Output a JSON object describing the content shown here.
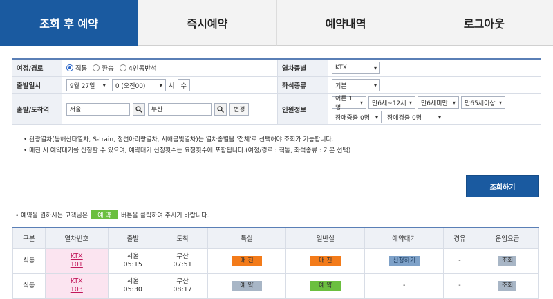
{
  "tabs": [
    "조회 후 예약",
    "즉시예약",
    "예약내역",
    "로그아웃"
  ],
  "form": {
    "route_label": "여정/경로",
    "route_options": [
      "직통",
      "환승",
      "4인동반석"
    ],
    "train_type_label": "열차종별",
    "train_type_value": "KTX",
    "depart_label": "출발일시",
    "date_value": "9월 27일",
    "time_value": "0 (오전00)",
    "hour_unit": "시",
    "weekday": "수",
    "seat_label": "좌석종류",
    "seat_value": "기본",
    "station_label": "출발/도착역",
    "from_station": "서울",
    "to_station": "부산",
    "swap_label": "변경",
    "passenger_label": "인원정보",
    "passengers": [
      "어른 1명",
      "만6세~12세",
      "만6세미만",
      "만65세이상",
      "장애중증 0명",
      "장애경증 0명"
    ]
  },
  "notes": [
    "• 관광열차(동해산타열차, S-train, 정선아리랑열차, 서해금빛열차)는 열차종별을 '전체'로 선택해야 조회가 가능합니다.",
    "• 매진 시 예약대기를 신청할 수 있으며, 예약대기 신청횟수는 요청횟수에 포함됩니다.(여정/경로 : 직통, 좌석종류 : 기본 선택)"
  ],
  "search_button": "조회하기",
  "tip": {
    "prefix": "• 예약을 원하시는 고객님은",
    "badge": "예 약",
    "suffix": "버튼을 클릭하여 주시기 바랍니다."
  },
  "table": {
    "headers": [
      "구분",
      "열차번호",
      "출발",
      "도착",
      "특실",
      "일반실",
      "예약대기",
      "경유",
      "운임요금"
    ],
    "rows": [
      {
        "type": "직통",
        "train": "KTX",
        "no": "101",
        "dep_st": "서울",
        "dep_t": "05:15",
        "arr_st": "부산",
        "arr_t": "07:51",
        "first": "매 진",
        "normal": "매 진",
        "wait": "신청하기",
        "via": "-",
        "fare": "조회"
      },
      {
        "type": "직통",
        "train": "KTX",
        "no": "103",
        "dep_st": "서울",
        "dep_t": "05:30",
        "arr_st": "부산",
        "arr_t": "08:17",
        "first": "예 약",
        "normal": "예 약",
        "wait": "-",
        "via": "-",
        "fare": "조회"
      }
    ]
  },
  "colors": {
    "accent": "#1a5aa0",
    "sold_out": "#f37b1a",
    "reserve": "#6bbf3f"
  }
}
